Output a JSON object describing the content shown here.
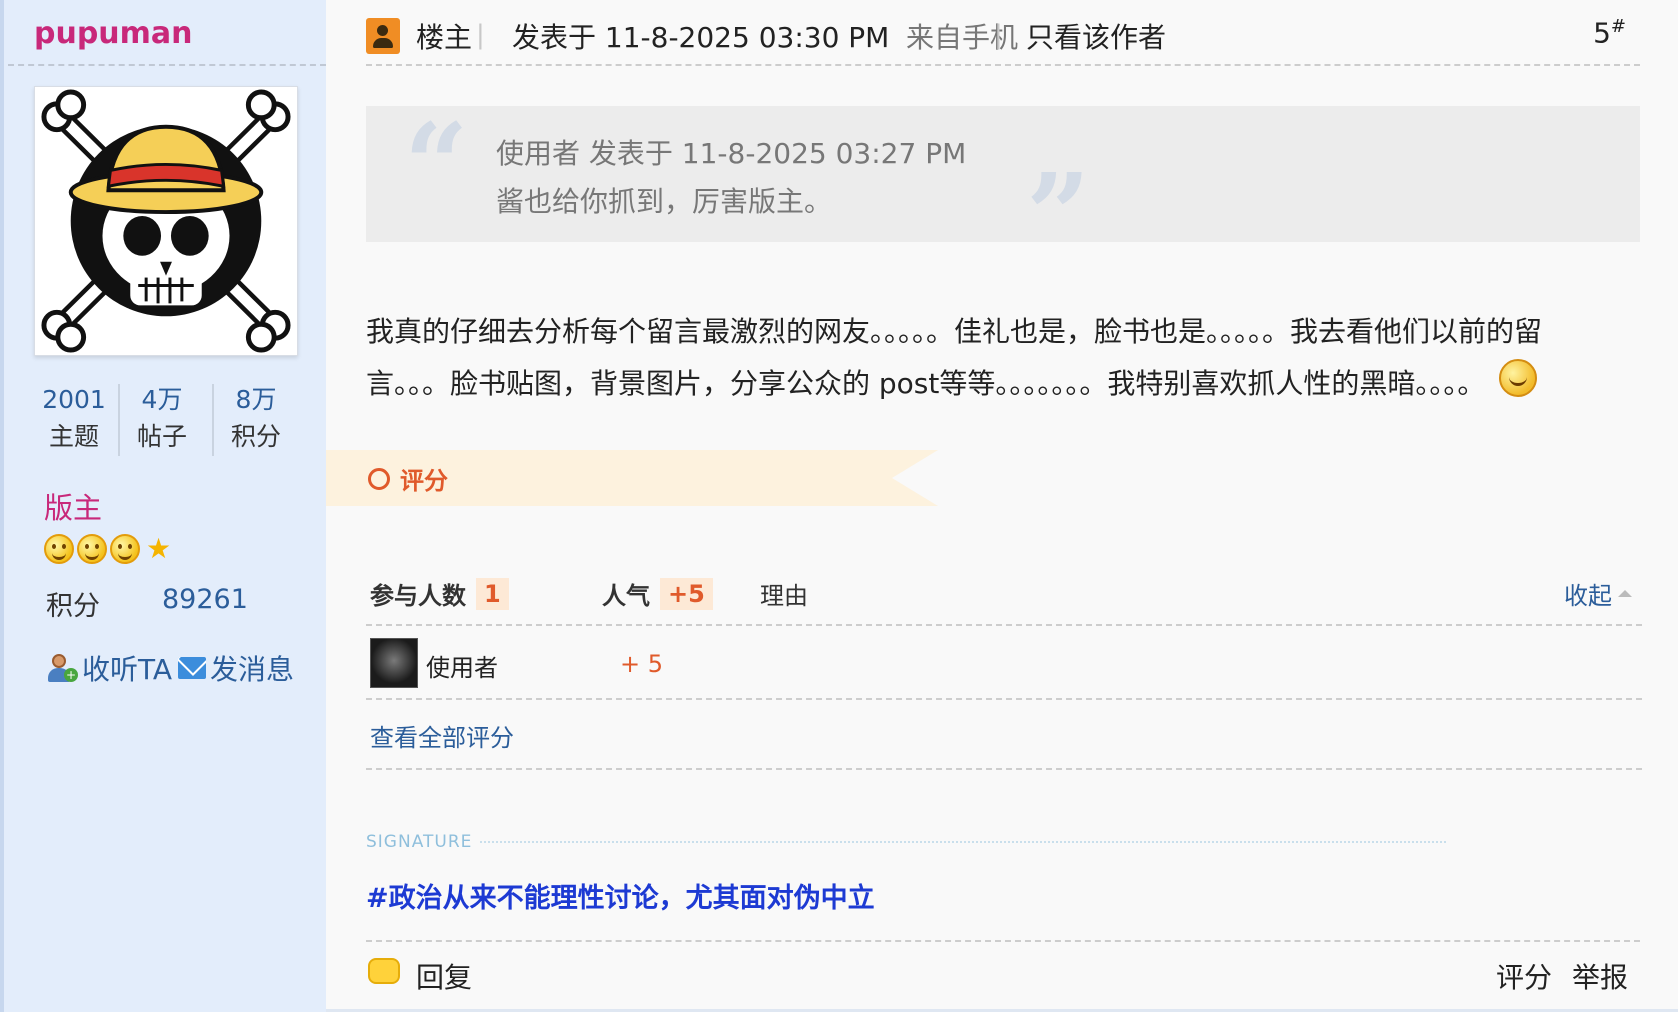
{
  "user": {
    "name": "pupuman",
    "stats": [
      {
        "value": "2001",
        "label": "主题"
      },
      {
        "value": "4万",
        "label": "帖子"
      },
      {
        "value": "8万",
        "label": "积分"
      }
    ],
    "role": "版主",
    "rank_icons": [
      "smiley-icon",
      "smiley-icon",
      "smiley-icon",
      "star-icon"
    ],
    "points_label": "积分",
    "points_value": "89261",
    "follow_label": "收听TA",
    "message_label": "发消息"
  },
  "post": {
    "owner_label": "楼主",
    "posted_at": "发表于 11-8-2025 03:30 PM",
    "source": "来自手机",
    "only_author_label": "只看该作者",
    "floor_number": "5",
    "floor_symbol": "#",
    "quote": {
      "meta": "使用者 发表于 11-8-2025 03:27 PM",
      "text": "酱也给你抓到，厉害版主。"
    },
    "body_line1": "我真的仔细去分析每个留言最激烈的网友。。。。。佳礼也是，脸书也是。。。。。我去看他们以前的留",
    "body_line2": "言。。。脸书贴图，背景图片，分享公众的 post等等。。。。。。。我特别喜欢抓人性的黑暗。。。。",
    "body_emoji": "smirk-emoji-icon"
  },
  "rating": {
    "title": "评分",
    "participants_label": "参与人数",
    "participants_count": "1",
    "popularity_label": "人气",
    "popularity_value": "+5",
    "reason_label": "理由",
    "collapse_label": "收起",
    "entries": [
      {
        "user": "使用者",
        "score": "+ 5"
      }
    ],
    "view_all_label": "查看全部评分"
  },
  "signature": {
    "label": "SIGNATURE",
    "text": "#政治从来不能理性讨论，尤其面对伪中立"
  },
  "footer": {
    "reply_label": "回复",
    "rate_label": "评分",
    "report_label": "举报"
  },
  "colors": {
    "username": "#c8287a",
    "link": "#2b5d9a",
    "accent_orange": "#e05a2b",
    "signature": "#1d3ad3",
    "sidebar_bg": "#e3edfb"
  }
}
